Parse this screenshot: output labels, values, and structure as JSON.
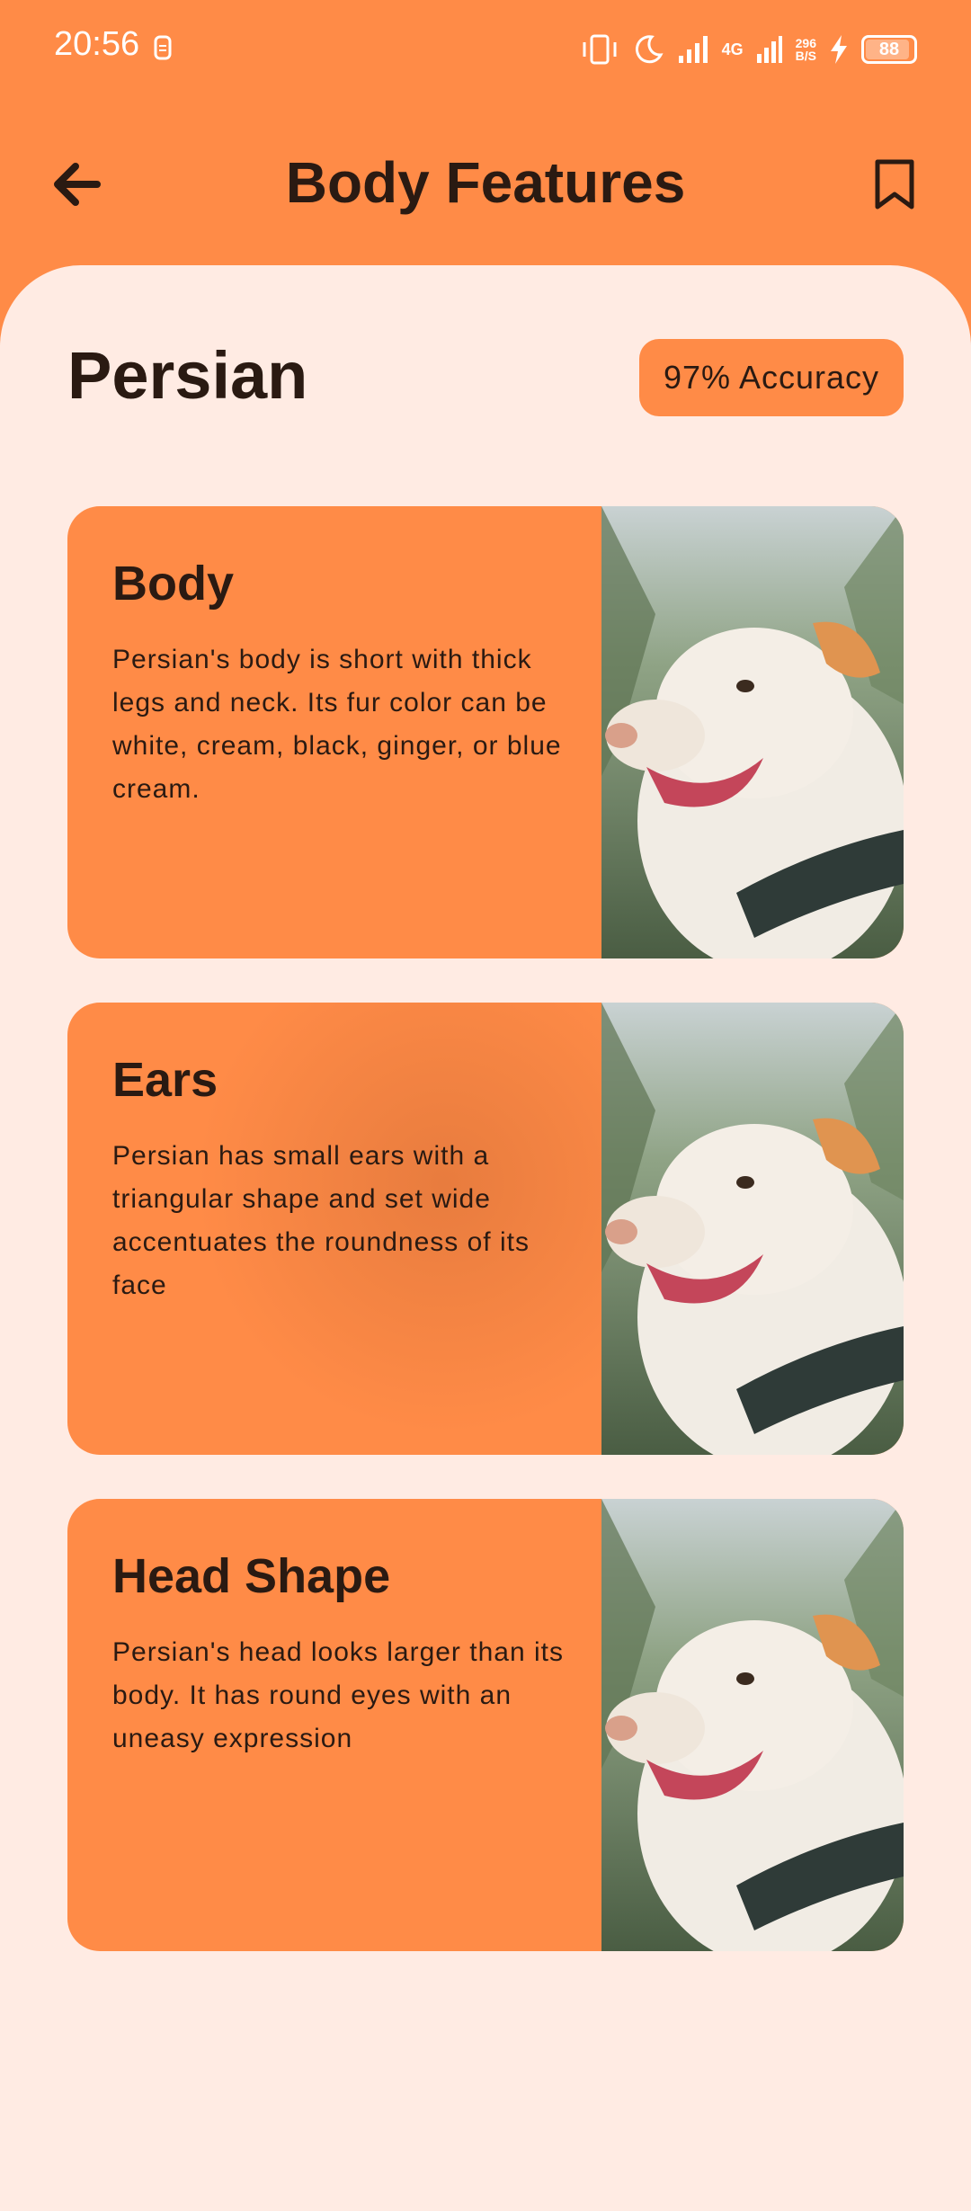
{
  "status_bar": {
    "time": "20:56",
    "network": "4G",
    "speed_value": "296",
    "speed_unit": "B/S",
    "battery": "88"
  },
  "app_bar": {
    "title": "Body Features",
    "back_icon": "arrow-left-icon",
    "bookmark_icon": "bookmark-icon"
  },
  "breed": {
    "name": "Persian",
    "accuracy": "97% Accuracy"
  },
  "features": [
    {
      "title": "Body",
      "description": "Persian's body is short with thick legs and neck. Its fur color can be white, cream, black, ginger, or blue cream."
    },
    {
      "title": "Ears",
      "description": "Persian has small ears with  a triangular shape and set wide accentuates the roundness of its face"
    },
    {
      "title": "Head Shape",
      "description": "Persian's head looks larger than its body. It has round eyes with an uneasy expression"
    }
  ],
  "colors": {
    "accent": "#FF8B47",
    "sheet_bg": "#FFEBE3",
    "text": "#2A1A12"
  }
}
